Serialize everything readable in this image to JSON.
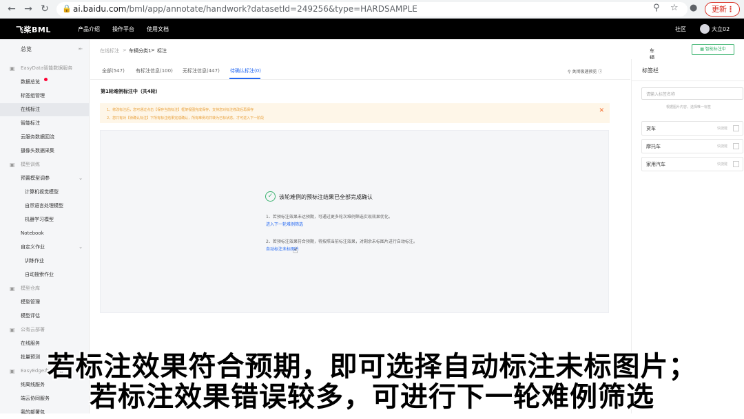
{
  "browser": {
    "url_host": "ai.baidu.com",
    "url_path": "/bml/app/annotate/handwork?datasetId=249256&type=HARDSAMPLE",
    "update_label": "更新",
    "back_icon": "arrow-left-icon",
    "forward_icon": "arrow-right-icon",
    "reload_icon": "reload-icon"
  },
  "header": {
    "logo": "飞桨BML",
    "nav": [
      "产品介绍",
      "操作平台",
      "使用文档"
    ],
    "community": "社区",
    "user": "大立02"
  },
  "sidebar": {
    "overview": "总览",
    "items": [
      {
        "label": "EasyData智能数据服务",
        "group": true,
        "icon": "data-icon"
      },
      {
        "label": "数据总览"
      },
      {
        "label": "标签组管理"
      },
      {
        "label": "在线标注",
        "active": true
      },
      {
        "label": "智能标注"
      },
      {
        "label": "云服务数据回流"
      },
      {
        "label": "摄像头数据采集"
      },
      {
        "label": "模型训练",
        "group": true,
        "icon": "train-icon"
      },
      {
        "label": "预置模型调参",
        "chevron": true
      },
      {
        "label": "计算机视觉模型",
        "sub": true
      },
      {
        "label": "自然语言处理模型",
        "sub": true
      },
      {
        "label": "机器学习模型",
        "sub": true
      },
      {
        "label": "Notebook"
      },
      {
        "label": "自定义作业",
        "chevron": true
      },
      {
        "label": "训练作业",
        "sub": true
      },
      {
        "label": "自动搜索作业",
        "sub": true
      },
      {
        "label": "模型仓库",
        "group": true,
        "icon": "repo-icon"
      },
      {
        "label": "模型管理"
      },
      {
        "label": "模型评估"
      },
      {
        "label": "公有云部署",
        "group": true,
        "icon": "cloud-icon"
      },
      {
        "label": "在线服务"
      },
      {
        "label": "批量预测"
      },
      {
        "label": "EasyEdge本地部署",
        "group": true,
        "icon": "edge-icon"
      },
      {
        "label": "纯离线服务"
      },
      {
        "label": "端云协同服务"
      },
      {
        "label": "我的部署包"
      }
    ]
  },
  "main": {
    "breadcrumb": [
      "在线标注",
      "车辆分类1",
      "标注"
    ],
    "model_select": "车辆分类1 V1",
    "smart_btn": "智能标注中",
    "tabs": [
      {
        "label": "全部(547)"
      },
      {
        "label": "有标注信息(100)"
      },
      {
        "label": "无标注信息(447)"
      },
      {
        "label": "待确认标注(0)",
        "active": true
      }
    ],
    "close_preview": "关闭极速预览",
    "round_title": "第1轮难例标注中（共4轮）",
    "warnings": [
      "1、修改标注后，您可通过点击【保存当前标注】框架视图完成保存，支持您对标注修改后再保存",
      "2、您只有对【待确认标注】下所有标注结果完成确认，所有难例均并转为已标状态，才可进入下一阶段"
    ],
    "done_text": "该轮难例的预标注结果已全部完成确认",
    "tip1": "1、若预标注效果未达预期，可通过更多轮次难例筛选实现效果优化。",
    "link1": "进入下一轮难例筛选",
    "tip2": "2、若预标注效果符合预期，将按照当前标注效果，对剩余未标图片进行自动标注。",
    "link2": "自动标注未标图片"
  },
  "label_panel": {
    "title": "标签栏",
    "search_placeholder": "请输入标签名称",
    "hint": "根据图片内容，选择唯一标签",
    "labels": [
      {
        "name": "货车",
        "key": "快捷键"
      },
      {
        "name": "摩托车",
        "key": "快捷键"
      },
      {
        "name": "家用汽车",
        "key": "快捷键"
      }
    ]
  },
  "subtitle": {
    "line1": "若标注效果符合预期，即可选择自动标注未标图片；",
    "line2": "若标注效果错误较多，可进行下一轮难例筛选"
  }
}
